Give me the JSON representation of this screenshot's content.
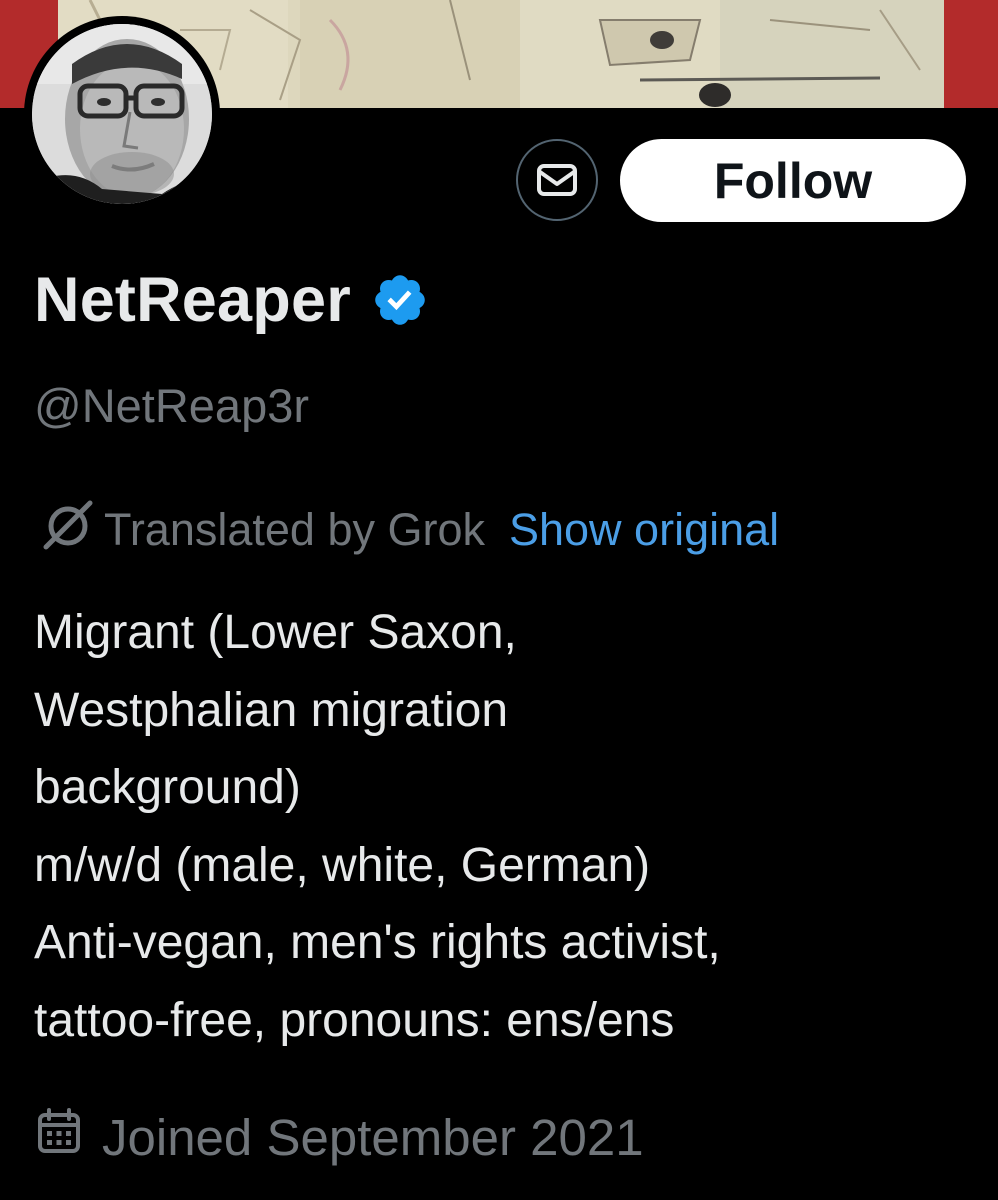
{
  "profile": {
    "display_name": "NetReaper",
    "handle": "@NetReap3r",
    "verified": true,
    "avatar_icon": "avatar-photo",
    "banner_icon": "banner-painting"
  },
  "actions": {
    "message_icon": "envelope-icon",
    "follow_label": "Follow"
  },
  "translation": {
    "label": "Translated by Grok",
    "show_original_label": "Show original",
    "icon": "grok-icon"
  },
  "bio": {
    "lines": [
      "Migrant (Lower Saxon,",
      "Westphalian migration",
      "background)",
      "m/w/d (male, white, German)",
      "Anti-vegan, men's rights activist,",
      "tattoo-free, pronouns: ens/ens"
    ]
  },
  "joined": {
    "label": "Joined September 2021",
    "icon": "calendar-icon"
  },
  "colors": {
    "background": "#000000",
    "primary_text": "#e7e9ea",
    "secondary_text": "#71767b",
    "link": "#4b9ee6",
    "verified_badge": "#1d9bf0",
    "follow_bg": "#ffffff",
    "banner_border": "#b32b2b"
  }
}
